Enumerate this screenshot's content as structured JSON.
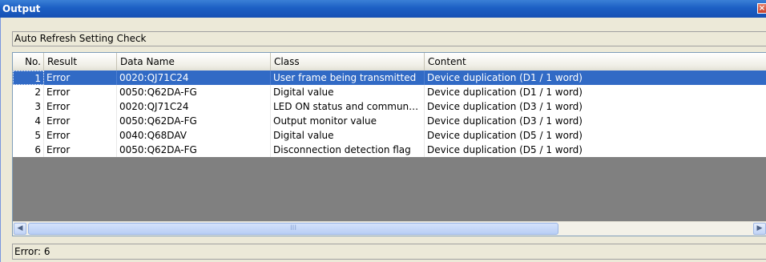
{
  "window": {
    "title": "Output",
    "close_icon": "×"
  },
  "check_title": "Auto Refresh Setting Check",
  "table": {
    "columns": [
      "No.",
      "Result",
      "Data Name",
      "Class",
      "Content"
    ],
    "rows": [
      {
        "no": "1",
        "result": "Error",
        "data_name": "0020:QJ71C24",
        "class": "User frame being transmitted",
        "content": "Device duplication (D1 / 1 word)",
        "selected": true
      },
      {
        "no": "2",
        "result": "Error",
        "data_name": "0050:Q62DA-FG",
        "class": "Digital value",
        "content": "Device duplication (D1 / 1 word)",
        "selected": false
      },
      {
        "no": "3",
        "result": "Error",
        "data_name": "0020:QJ71C24",
        "class": "LED ON status and commun…",
        "content": "Device duplication (D3 / 1 word)",
        "selected": false
      },
      {
        "no": "4",
        "result": "Error",
        "data_name": "0050:Q62DA-FG",
        "class": "Output monitor value",
        "content": "Device duplication (D3 / 1 word)",
        "selected": false
      },
      {
        "no": "5",
        "result": "Error",
        "data_name": "0040:Q68DAV",
        "class": "Digital value",
        "content": "Device duplication (D5 / 1 word)",
        "selected": false
      },
      {
        "no": "6",
        "result": "Error",
        "data_name": "0050:Q62DA-FG",
        "class": "Disconnection detection flag",
        "content": "Device duplication (D5 / 1 word)",
        "selected": false
      }
    ]
  },
  "scrollbar": {
    "left_icon": "◀",
    "right_icon": "▶",
    "grip": "III"
  },
  "status": "Error: 6",
  "colors": {
    "titlebar": "#1c5fc4",
    "selection": "#316ac5",
    "empty_area": "#808080"
  }
}
